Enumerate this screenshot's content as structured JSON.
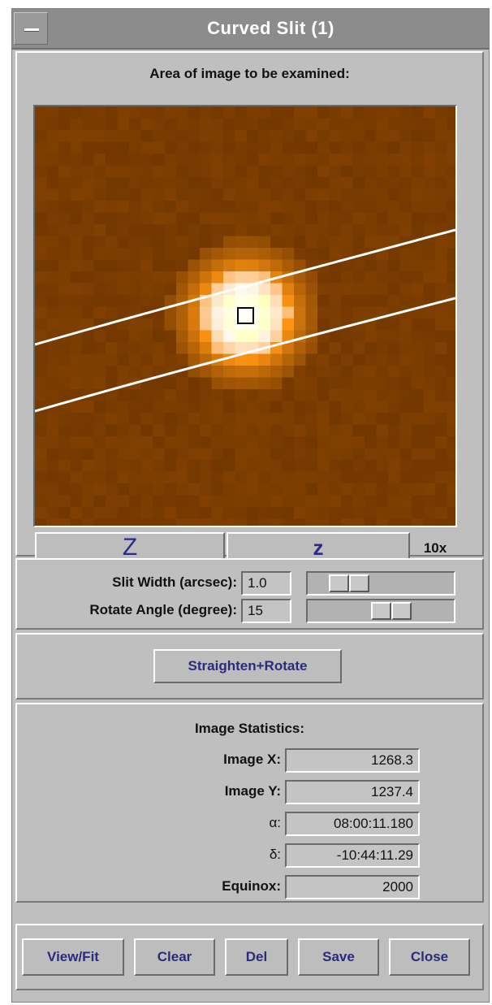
{
  "window": {
    "title": "Curved Slit (1)"
  },
  "image_panel": {
    "title": "Area of image to be examined:",
    "zoom_out_label": "Z",
    "zoom_in_label": "z",
    "zoom_level": "10x"
  },
  "slit": {
    "width_label": "Slit Width (arcsec):",
    "width_value": "1.0",
    "width_slider_fraction": 0.2,
    "angle_label": "Rotate Angle (degree):",
    "angle_value": "15",
    "angle_slider_fraction": 0.6
  },
  "actions": {
    "straighten_label": "Straighten+Rotate"
  },
  "stats": {
    "title": "Image Statistics:",
    "rows": [
      {
        "label": "Image X:",
        "value": "1268.3"
      },
      {
        "label": "Image Y:",
        "value": "1237.4"
      },
      {
        "label": "α:",
        "value": "08:00:11.180"
      },
      {
        "label": "δ:",
        "value": "-10:44:11.29"
      },
      {
        "label": "Equinox:",
        "value": "2000"
      }
    ]
  },
  "buttons": {
    "view_fit": "View/Fit",
    "clear": "Clear",
    "del": "Del",
    "save": "Save",
    "close": "Close"
  },
  "colors": {
    "image_background": "#7a3c00",
    "star_core": "#ffffff",
    "star_halo": "#ff8a1e",
    "button_text": "#2b2b7a",
    "window_gray": "#bfbfbf"
  }
}
